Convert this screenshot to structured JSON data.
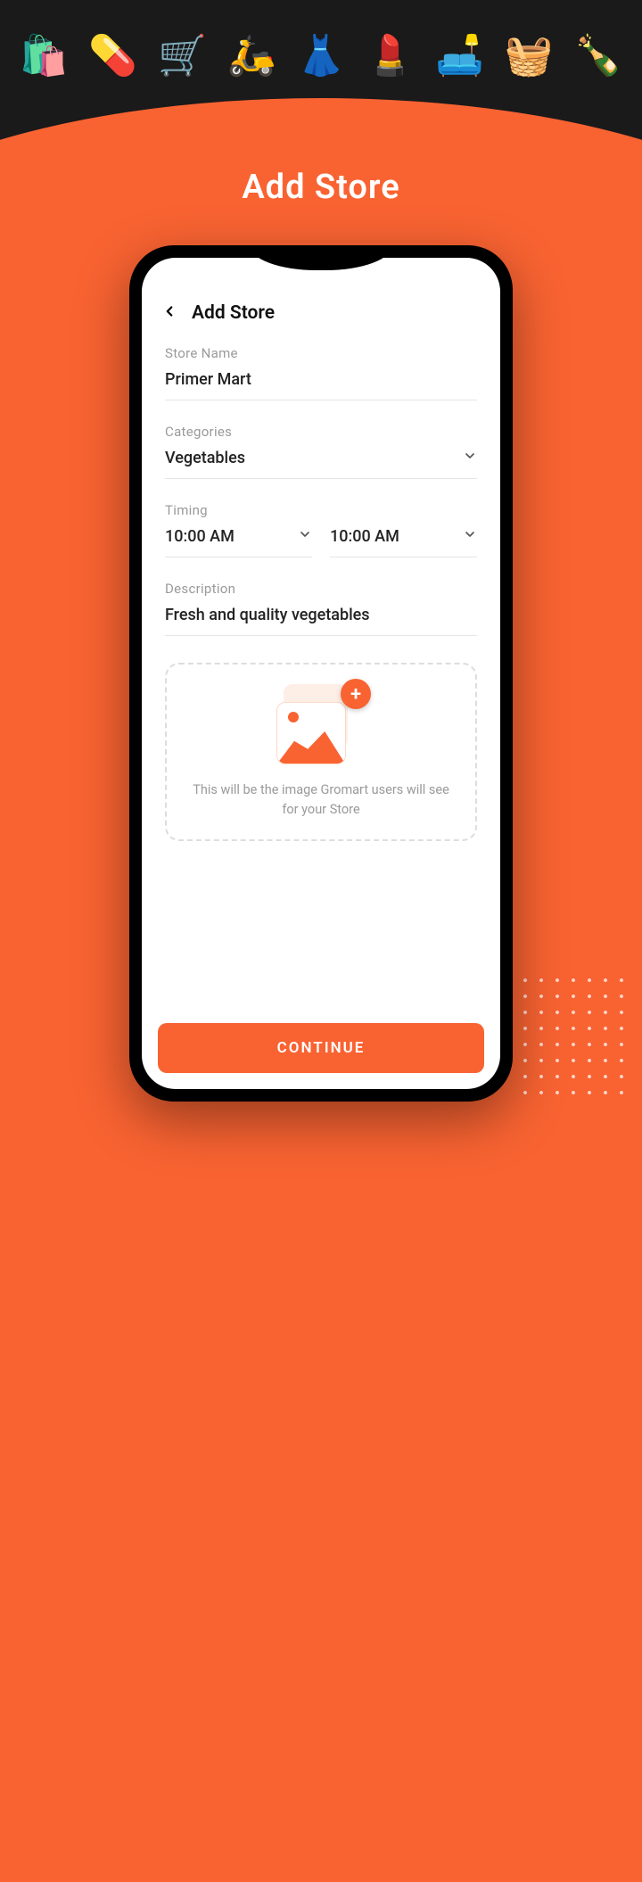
{
  "page_title": "Add Store",
  "screen": {
    "title": "Add Store",
    "fields": {
      "store_name": {
        "label": "Store Name",
        "value": "Primer Mart"
      },
      "categories": {
        "label": "Categories",
        "value": "Vegetables"
      },
      "timing": {
        "label": "Timing",
        "open": "10:00 AM",
        "close": "10:00 AM"
      },
      "description": {
        "label": "Description",
        "value": "Fresh and quality vegetables"
      }
    },
    "upload_hint": "This will be the image Gromart users will see for your Store",
    "continue_label": "CONTINUE"
  },
  "header_icons": [
    "grocery-bag",
    "medicine",
    "shopping-cart",
    "delivery-scooter",
    "fashion",
    "cosmetics",
    "furniture",
    "flower-basket",
    "wine-bottle"
  ]
}
